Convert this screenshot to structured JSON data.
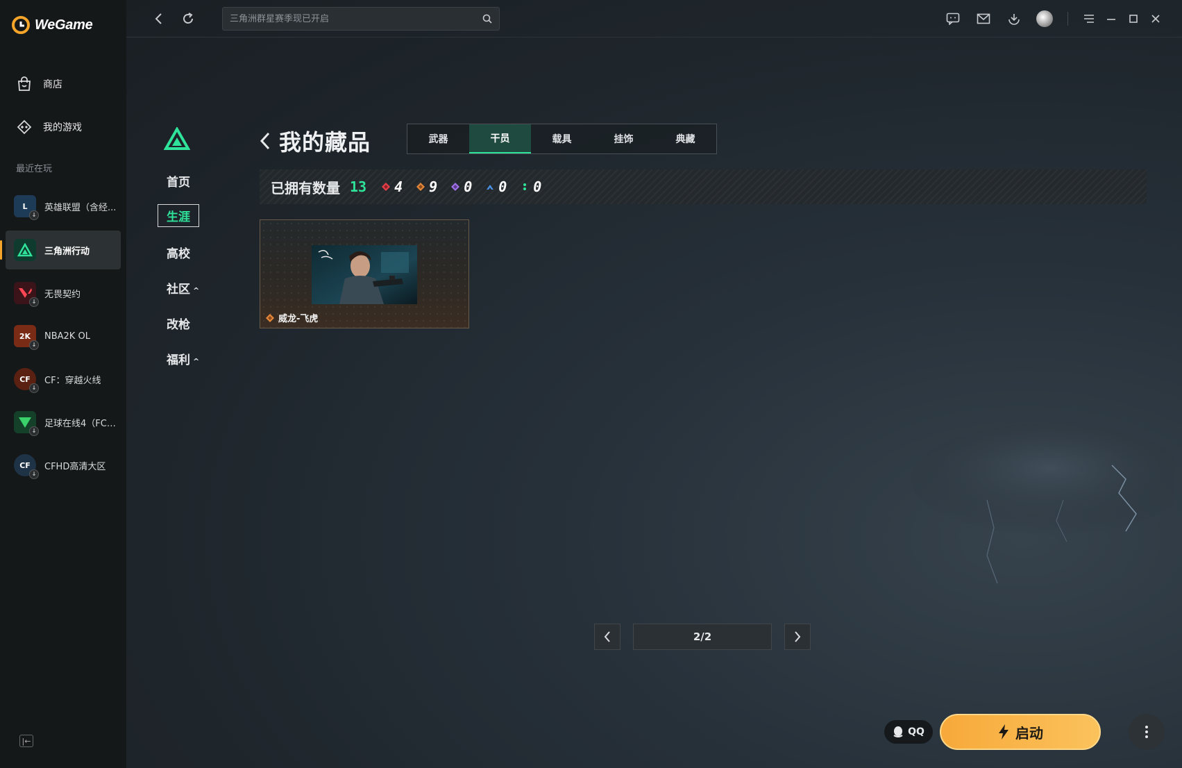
{
  "app": {
    "brand": "WeGame"
  },
  "sidebar": {
    "nav": [
      {
        "label": "商店",
        "icon": "store-bag-icon"
      },
      {
        "label": "我的游戏",
        "icon": "gamepad-icon"
      }
    ],
    "recent_title": "最近在玩",
    "games": [
      {
        "label": "英雄联盟（含经...",
        "icon": "league-of-legends-icon",
        "color": "#1d3b57"
      },
      {
        "label": "三角洲行动",
        "icon": "delta-force-icon",
        "color": "#0f3b2f",
        "active": true
      },
      {
        "label": "无畏契约",
        "icon": "valorant-icon",
        "color": "#3a1419"
      },
      {
        "label": "NBA2K OL",
        "icon": "nba2k-icon",
        "color": "#7a2b16"
      },
      {
        "label": "CF：穿越火线",
        "icon": "crossfire-icon",
        "color": "#5a2012"
      },
      {
        "label": "足球在线4（FC ...",
        "icon": "fc-online-icon",
        "color": "#14402a"
      },
      {
        "label": "CFHD高清大区",
        "icon": "cfhd-icon",
        "color": "#1e3346"
      }
    ]
  },
  "topbar": {
    "search_placeholder": "三角洲群星赛季现已开启"
  },
  "game_nav": {
    "items": [
      {
        "label": "首页"
      },
      {
        "label": "生涯",
        "active": true
      },
      {
        "label": "高校"
      },
      {
        "label": "社区",
        "caret": "^"
      },
      {
        "label": "改枪"
      },
      {
        "label": "福利",
        "caret": "^"
      }
    ]
  },
  "collection": {
    "title": "我的藏品",
    "tabs": [
      "武器",
      "干员",
      "载具",
      "挂饰",
      "典藏"
    ],
    "active_tab": "干员",
    "stats": {
      "label": "已拥有数量",
      "total": "13",
      "by_rarity": [
        {
          "color": "#e8404a",
          "count": "4"
        },
        {
          "color": "#e6883a",
          "count": "9"
        },
        {
          "color": "#a070e8",
          "count": "0"
        },
        {
          "color": "#4a90e2",
          "count": "0"
        },
        {
          "color": "#2fe39a",
          "count": "0"
        }
      ]
    },
    "items": [
      {
        "name": "威龙-飞虎",
        "rarity_color": "#e6883a"
      }
    ]
  },
  "pagination": {
    "display": "2/2"
  },
  "launch": {
    "qq_label": "QQ",
    "launch_label": "启动"
  }
}
